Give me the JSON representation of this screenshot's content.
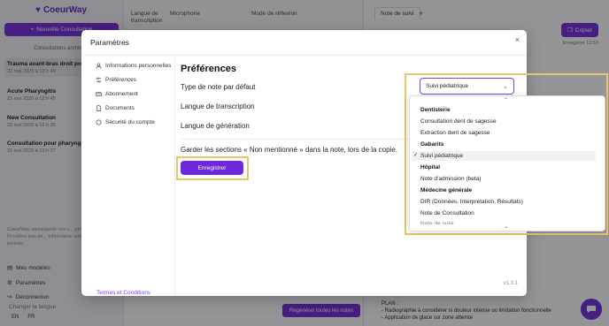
{
  "app": {
    "logo": "CoeurWay",
    "new_consultation": "Nouvelle Consultation",
    "consultations_link": "Consultations archivées",
    "consultations": [
      {
        "title": "Trauma avant-bras droit post",
        "date": "22 mai 2025 à 12 h 49"
      },
      {
        "title": "Acute Pharyngitis",
        "date": "22 mai 2025 à 12 h 45"
      },
      {
        "title": "New Consultation",
        "date": "22 mai 2025 à 12 h 35"
      },
      {
        "title": "Consultation pour pharyngite",
        "date": "21 mai 2025 à 13 h 27"
      }
    ],
    "sidebar_note": "CoeurWay sauvegarde vos c... pendant 48h. N'oubliez pas de... information avant la fin de ... période.",
    "menu": {
      "models": "Mes modèles",
      "settings": "Paramètres",
      "logout": "Déconnexion"
    },
    "change_language": "Changer la langue",
    "languages": [
      "EN",
      "FR"
    ],
    "top_columns": {
      "note_type": "Langue de transcription",
      "microphone": "Microphone",
      "reflection": "Mode de réflexion"
    },
    "regen_all": "Regénérer toutes les notes",
    "note_tab": "Note de suivi",
    "copy_label": "Copier",
    "saved_label": "Enregistré 12:53",
    "plan_title": "PLAN :",
    "plan_lines": [
      "- Radiographie à considérer si douleur intense ou limitation fonctionnelle",
      "- Application de glace sur zone atteinte"
    ]
  },
  "modal": {
    "title": "Paramètres",
    "close_glyph": "×",
    "nav": [
      {
        "label": "Informations personnelles",
        "icon": "user-icon"
      },
      {
        "label": "Préférences",
        "icon": "sliders-icon"
      },
      {
        "label": "Abonnement",
        "icon": "card-icon"
      },
      {
        "label": "Documents",
        "icon": "document-icon"
      },
      {
        "label": "Sécurité du compte",
        "icon": "shield-icon"
      }
    ],
    "terms": "Termes et Conditions",
    "content_title": "Préférences",
    "rows": {
      "note_type": "Type de note par défaut",
      "transcription": "Langue de transcription",
      "generation": "Langue de génération"
    },
    "sections_text": "Garder les sections « Non mentionné » dans la note, lors de la copie.",
    "save_label": "Enregistrer",
    "version": "v1.3.1"
  },
  "dropdown": {
    "selected": "Suivi pédiatrique",
    "groups": [
      {
        "name": "Dentisterie",
        "options": [
          "Consultation dent de sagesse",
          "Extraction dent de sagesse"
        ]
      },
      {
        "name": "Gabarits",
        "options": [
          "Suivi pédiatrique"
        ]
      },
      {
        "name": "Hôpital",
        "options": [
          "Note d'admission (beta)"
        ]
      },
      {
        "name": "Médecine générale",
        "options": [
          "DIR (Données, Interprétation, Résultats)",
          "Note de Consultation",
          "Note de suivi"
        ]
      }
    ]
  },
  "colors": {
    "accent": "#6d28d9",
    "highlight": "#e9c46a"
  }
}
